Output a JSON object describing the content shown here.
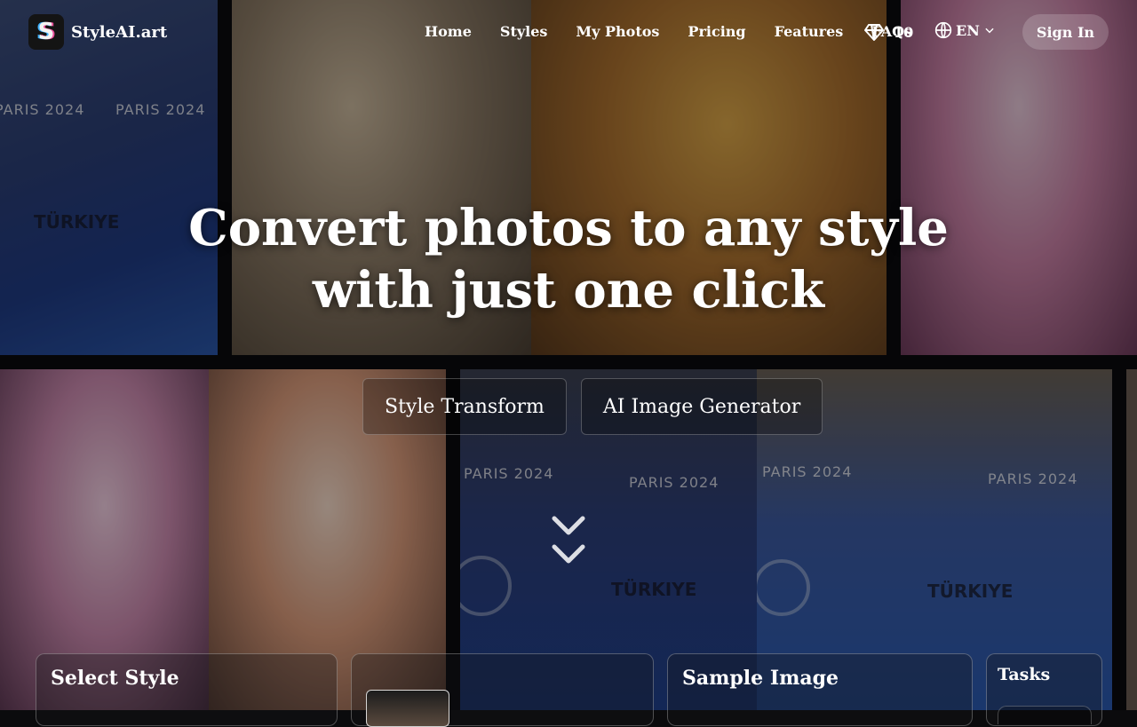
{
  "header": {
    "logo_text": "StyleAI.art",
    "nav": [
      "Home",
      "Styles",
      "My Photos",
      "Pricing",
      "Features",
      "FAQs"
    ],
    "credits": "10",
    "language": "EN",
    "sign_in": "Sign In"
  },
  "hero": {
    "title": "Convert photos to any style with just one click",
    "tabs": [
      "Style Transform",
      "AI Image Generator"
    ]
  },
  "background": {
    "banner_text": "PARIS 2024",
    "jersey_text": "TÜRKIYE"
  },
  "panels": {
    "select_style": "Select Style",
    "sample_image": "Sample Image",
    "tasks": "Tasks"
  },
  "icons": {
    "logo": "logo-icon",
    "credits": "diamond-icon",
    "language": "globe-icon",
    "language_dropdown": "chevron-down-icon",
    "scroll": "double-chevron-down-icon"
  },
  "colors": {
    "background": "#0b0b0d",
    "text": "#ffffff",
    "signin_bg": "rgba(255,255,255,0.18)"
  }
}
